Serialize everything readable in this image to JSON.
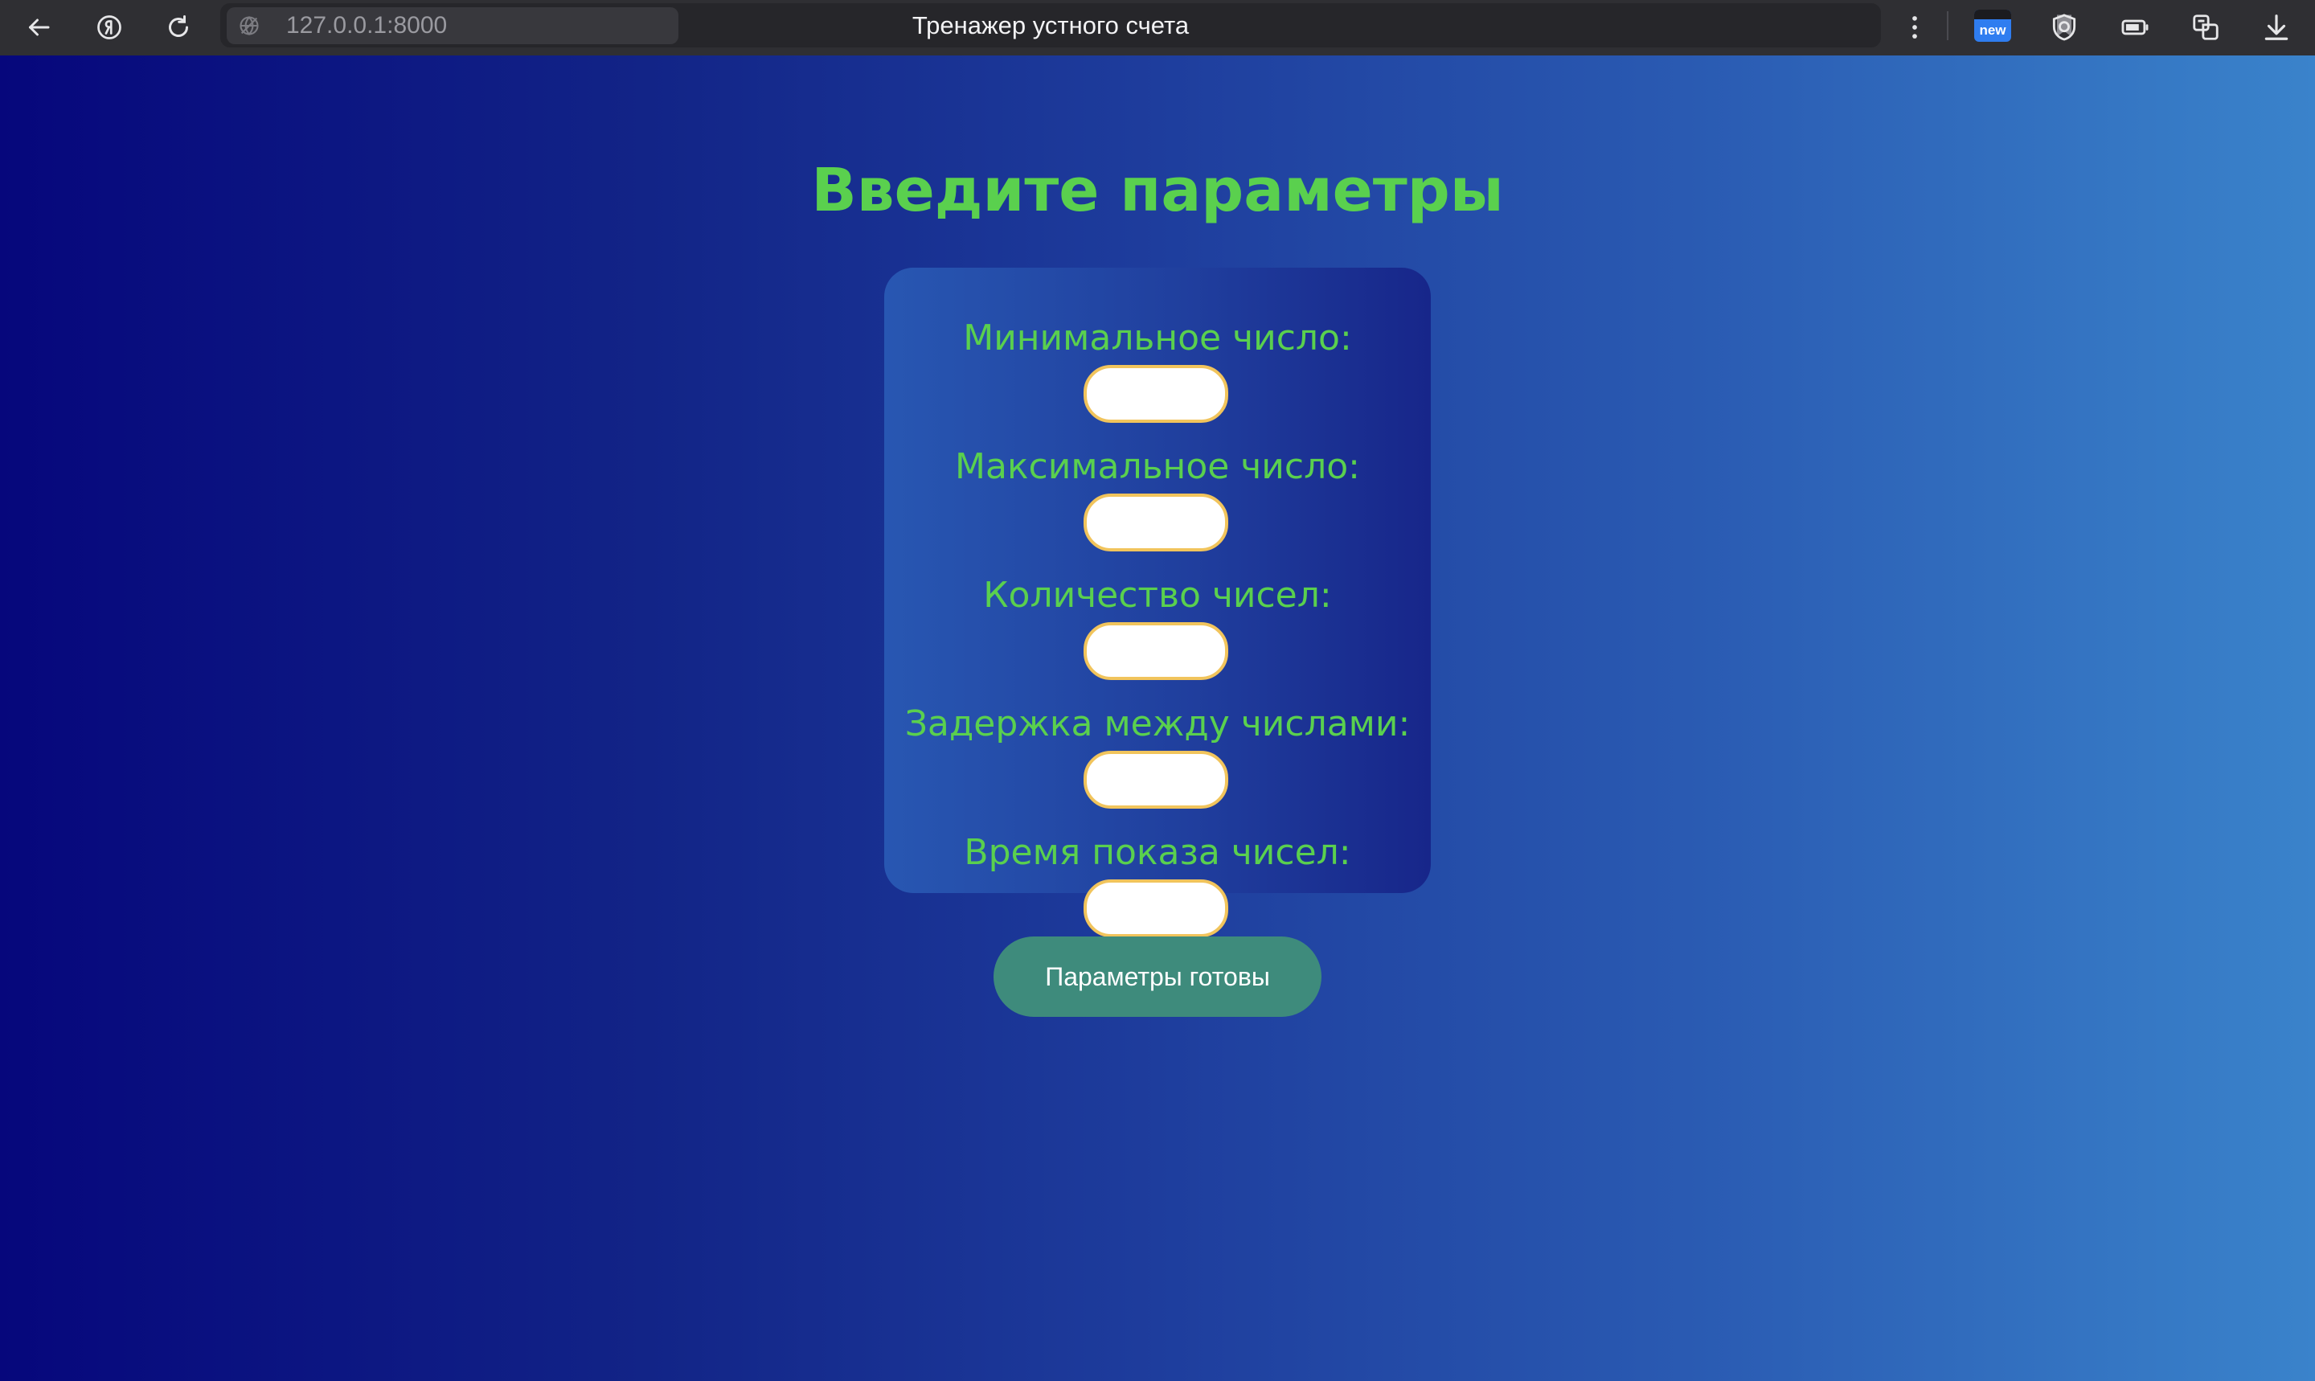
{
  "browser": {
    "url": "127.0.0.1:8000",
    "tab_title": "Тренажер устного счета",
    "extension_badge": "new",
    "icons": [
      "back-arrow-icon",
      "yandex-logo-icon",
      "reload-icon",
      "globe-icon",
      "bookmark-icon",
      "more-dots-icon",
      "shield-icon",
      "battery-icon",
      "translate-icon",
      "download-icon"
    ]
  },
  "page": {
    "heading": "Введите параметры",
    "fields": [
      {
        "label": "Минимальное число:",
        "value": ""
      },
      {
        "label": "Максимальное число:",
        "value": ""
      },
      {
        "label": "Количество чисел:",
        "value": ""
      },
      {
        "label": "Задержка между числами:",
        "value": ""
      },
      {
        "label": "Время показа чисел:",
        "value": ""
      }
    ],
    "submit_label": "Параметры готовы"
  },
  "colors": {
    "accent_green": "#5ad04e",
    "input_border": "#f1c45c",
    "button_bg": "#3e8b7c",
    "bg_left": "#06077c",
    "bg_right": "#3a83cb"
  }
}
